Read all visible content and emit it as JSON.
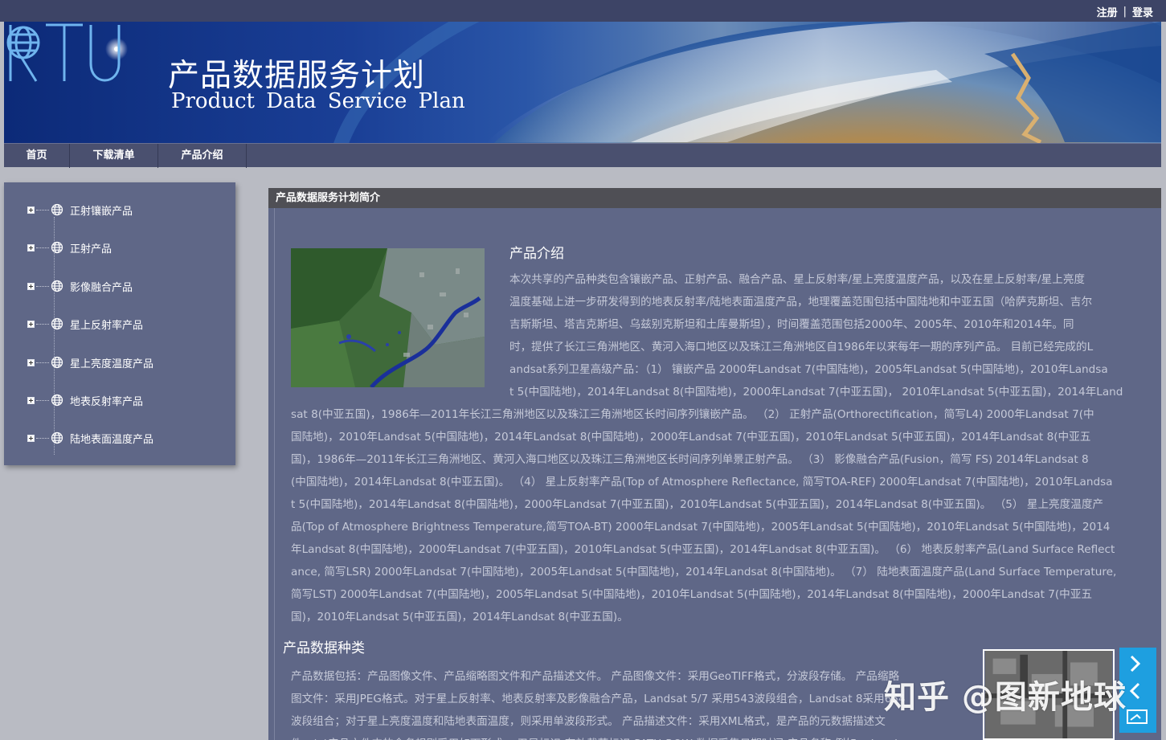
{
  "top_links": {
    "register": "注册",
    "separator": "|",
    "login": "登录"
  },
  "banner": {
    "title_cn": "产品数据服务计划",
    "title_en": "Product Data Service Plan",
    "logo_text": "RTU"
  },
  "nav": [
    "首页",
    "下载清单",
    "产品介绍"
  ],
  "sidebar": {
    "items": [
      "正射镶嵌产品",
      "正射产品",
      "影像融合产品",
      "星上反射率产品",
      "星上亮度温度产品",
      "地表反射率产品",
      "陆地表面温度产品"
    ]
  },
  "main": {
    "header": "产品数据服务计划简介",
    "intro_heading": "产品介绍",
    "intro_lines": [
      "本次共享的产品种类包含镶嵌产品、正射产品、融合产品、星上反射率/星上亮度温度产品，以及在星上反射率/星上亮度",
      "温度基础上进一步研发得到的地表反射率/陆地表面温度产品，地理覆盖范围包括中国陆地和中亚五国（哈萨克斯坦、吉尔",
      "吉斯斯坦、塔吉克斯坦、乌兹别克斯坦和土库曼斯坦），时间覆盖范围包括2000年、2005年、2010年和2014年。同",
      "时，提供了长江三角洲地区、黄河入海口地区以及珠江三角洲地区自1986年以来每年一期的序列产品。 目前已经完成的L",
      "andsat系列卫星高级产品：（1） 镶嵌产品 2000年Landsat 7(中国陆地)，2005年Landsat 5(中国陆地)，2010年Landsa",
      "t 5(中国陆地)，2014年Landsat 8(中国陆地)，2000年Landsat 7(中亚五国)， 2010年Landsat 5(中亚五国)，2014年Land"
    ],
    "body_lines": [
      "sat 8(中亚五国)，1986年—2011年长江三角洲地区以及珠江三角洲地区长时间序列镶嵌产品。 （2） 正射产品(Orthorectification，简写L4) 2000年Landsat 7(中",
      "国陆地)，2010年Landsat 5(中国陆地)，2014年Landsat 8(中国陆地)，2000年Landsat 7(中亚五国)，2010年Landsat 5(中亚五国)，2014年Landsat 8(中亚五",
      "国)，1986年—2011年长江三角洲地区、黄河入海口地区以及珠江三角洲地区长时间序列单景正射产品。 （3） 影像融合产品(Fusion，简写 FS) 2014年Landsat 8",
      "(中国陆地)，2014年Landsat 8(中亚五国)。 （4） 星上反射率产品(Top of Atmosphere Reflectance, 简写TOA-REF) 2000年Landsat 7(中国陆地)，2010年Landsa",
      "t 5(中国陆地)，2014年Landsat 8(中国陆地)，2000年Landsat 7(中亚五国)，2010年Landsat 5(中亚五国)，2014年Landsat 8(中亚五国)。 （5） 星上亮度温度产",
      "品(Top of Atmosphere Brightness Temperature,简写TOA-BT) 2000年Landsat 7(中国陆地)，2005年Landsat 5(中国陆地)，2010年Landsat 5(中国陆地)，2014",
      "年Landsat 8(中国陆地)，2000年Landsat 7(中亚五国)，2010年Landsat 5(中亚五国)，2014年Landsat 8(中亚五国)。 （6） 地表反射率产品(Land Surface Reflect",
      "ance, 简写LSR) 2000年Landsat 7(中国陆地)，2005年Landsat 5(中国陆地)，2014年Landsat 8(中国陆地)。 （7） 陆地表面温度产品(Land Surface Temperature,",
      "简写LST) 2000年Landsat 7(中国陆地)，2005年Landsat 5(中国陆地)，2010年Landsat 5(中国陆地)，2014年Landsat 8(中国陆地)，2000年Landsat 7(中亚五",
      "国)，2010年Landsat 5(中亚五国)，2014年Landsat 8(中亚五国)。"
    ],
    "types_heading": "产品数据种类",
    "types_lines": [
      "产品数据包括：产品图像文件、产品缩略图文件和产品描述文件。 产品图像文件：采用GeoTIFF格式，分波段存储。 产品缩略",
      "图文件：采用JPEG格式。对于星上反射率、地表反射率及影像融合产品，Landsat 5/7 采用543波段组合，Landsat 8采用654",
      "波段组合；对于星上亮度温度和陆地表面温度，则采用单波段形式。 产品描述文件：采用XML格式，是产品的元数据描述文",
      "件。(a)产品文件夹的命名规则采用如下形式： 卫星标识-有效载荷标识-PATH-ROW-数据采集日期时间-产品名称 例如： Lands"
    ]
  },
  "watermark": "知乎 @图新地球",
  "colors": {
    "topbar": "#3d4466",
    "nav": "#4a506f",
    "panel": "#5f6787",
    "header": "#4f4f55",
    "text": "#c5c9d8",
    "side_button": "#1e9fe0"
  }
}
